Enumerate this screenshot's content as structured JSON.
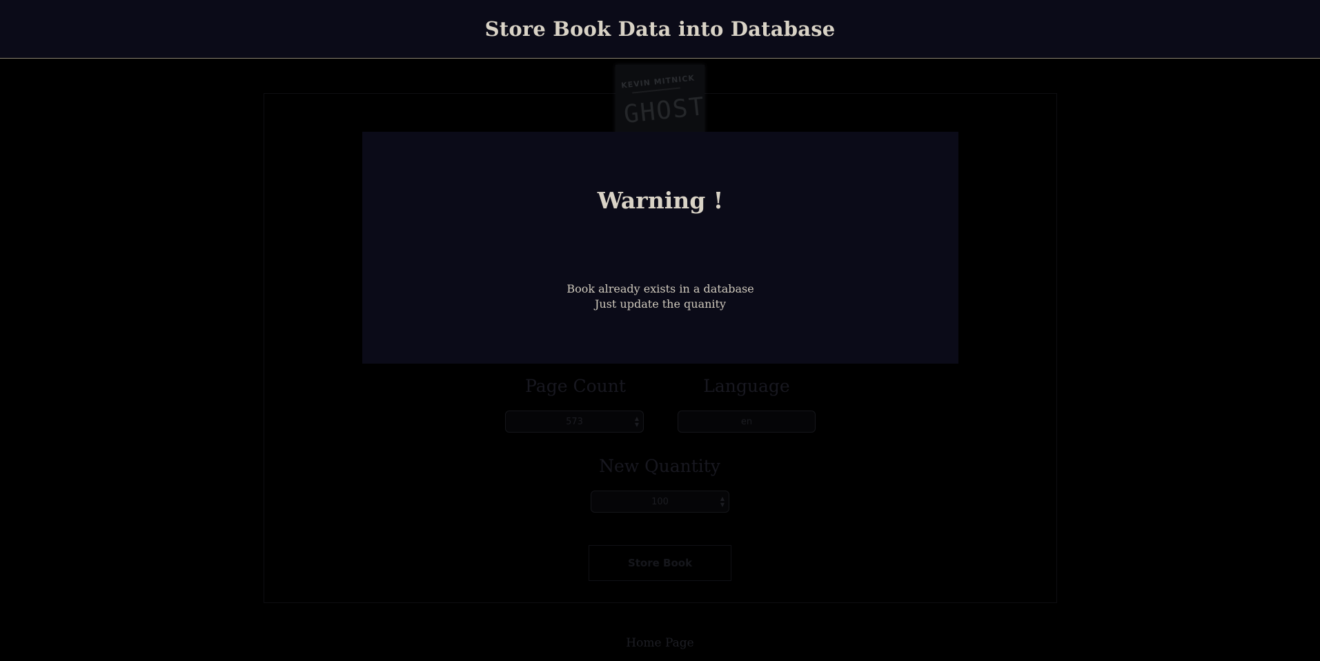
{
  "header": {
    "title": "Store Book Data into Database"
  },
  "book": {
    "cover_author": "KEVIN MITNICK",
    "cover_title": "GHOST",
    "cover_icon": "book-cover-image"
  },
  "form": {
    "page_count_label": "Page Count",
    "page_count_value": "573",
    "language_label": "Language",
    "language_value": "en",
    "quantity_label": "New Quantity",
    "quantity_value": "100",
    "store_button": "Store Book"
  },
  "footer": {
    "home_link": "Home Page"
  },
  "modal": {
    "title": "Warning !",
    "message_line1": "Book already exists in a database",
    "message_line2": "Just update the quanity"
  },
  "colors": {
    "header_bg": "#0b0b18",
    "page_bg": "#000000",
    "modal_bg": "#0b0b18",
    "text": "#d9d3c6",
    "header_border": "#8a8470"
  }
}
